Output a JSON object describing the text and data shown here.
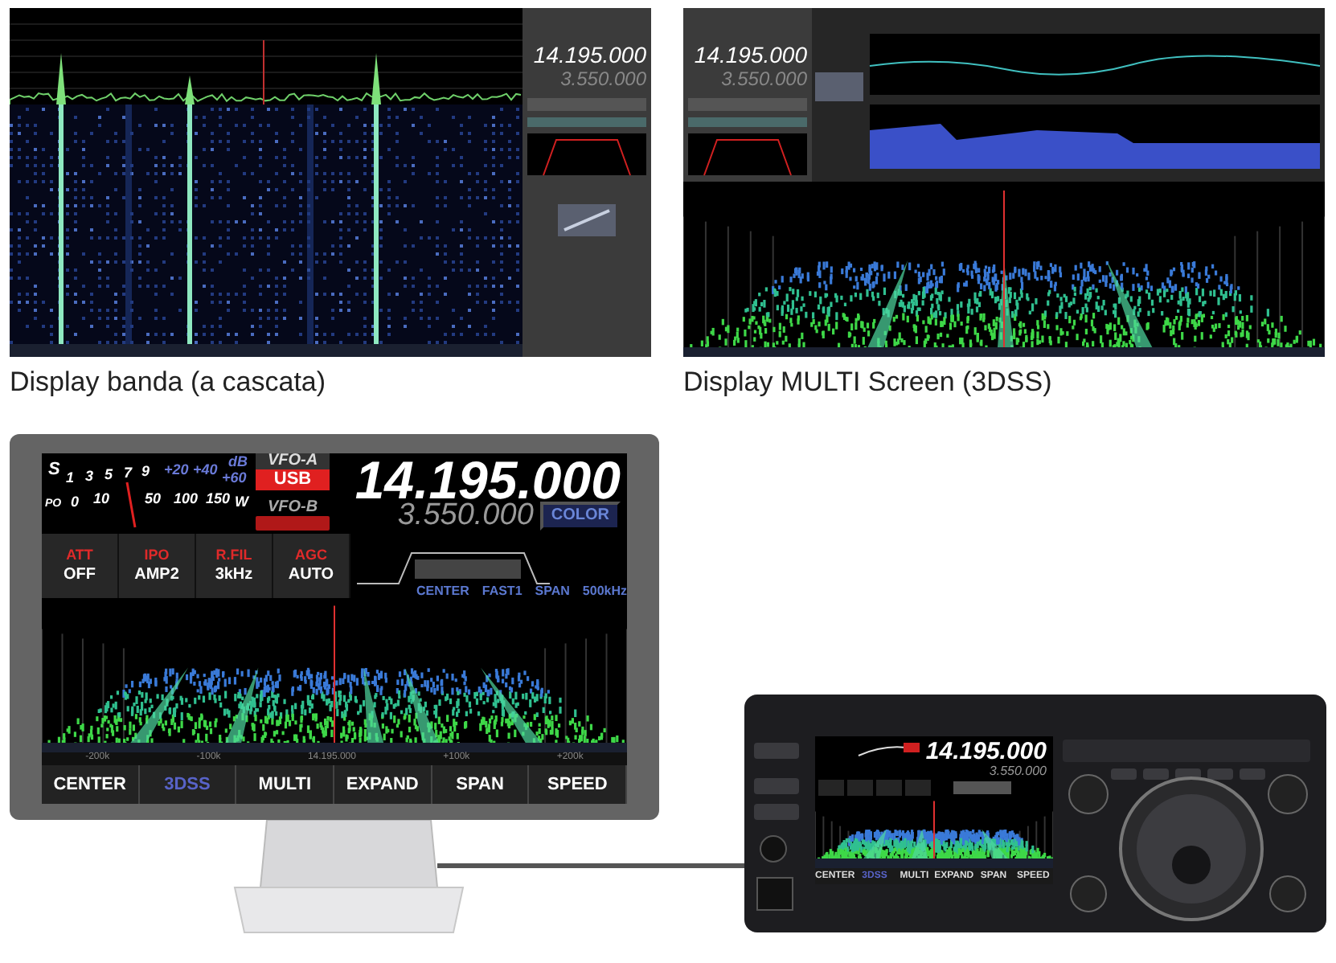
{
  "screens": [
    {
      "kind": "waterfall",
      "main_frequency": "14.195.000",
      "sub_frequency": "3.550.000",
      "caption": "Display banda (a cascata)"
    },
    {
      "kind": "multi",
      "main_frequency": "14.195.000",
      "sub_frequency": "3.550.000",
      "caption": "Display MULTI Screen (3DSS)"
    }
  ],
  "monitor": {
    "s_scale": [
      "S",
      "1",
      "3",
      "5",
      "7",
      "9",
      "+20",
      "+40",
      "dB",
      "+60"
    ],
    "po_scale": [
      "PO",
      "0",
      "10",
      "50",
      "100",
      "150",
      "W"
    ],
    "vfo_a": "VFO-A",
    "mode": "USB",
    "vfo_b": "VFO-B",
    "main_frequency": "14.195.000",
    "sub_frequency": "3.550.000",
    "color_button": "COLOR",
    "functions": [
      {
        "label": "ATT",
        "value": "OFF"
      },
      {
        "label": "IPO",
        "value": "AMP2"
      },
      {
        "label": "R.FIL",
        "value": "3kHz"
      },
      {
        "label": "AGC",
        "value": "AUTO"
      }
    ],
    "scope_info": [
      "CENTER",
      "FAST1",
      "SPAN",
      "500kHz"
    ],
    "axis_labels": [
      "-200k",
      "-100k",
      "14.195.000",
      "+100k",
      "+200k"
    ],
    "buttons": [
      {
        "label": "CENTER",
        "selected": false
      },
      {
        "label": "3DSS",
        "selected": true
      },
      {
        "label": "MULTI",
        "selected": false
      },
      {
        "label": "EXPAND",
        "selected": false
      },
      {
        "label": "SPAN",
        "selected": false
      },
      {
        "label": "SPEED",
        "selected": false
      }
    ]
  },
  "radio": {
    "main_frequency": "14.195.000",
    "sub_frequency": "3.550.000",
    "buttons": [
      {
        "label": "CENTER",
        "selected": false
      },
      {
        "label": "3DSS",
        "selected": true
      },
      {
        "label": "MULTI",
        "selected": false
      },
      {
        "label": "EXPAND",
        "selected": false
      },
      {
        "label": "SPAN",
        "selected": false
      },
      {
        "label": "SPEED",
        "selected": false
      }
    ]
  }
}
